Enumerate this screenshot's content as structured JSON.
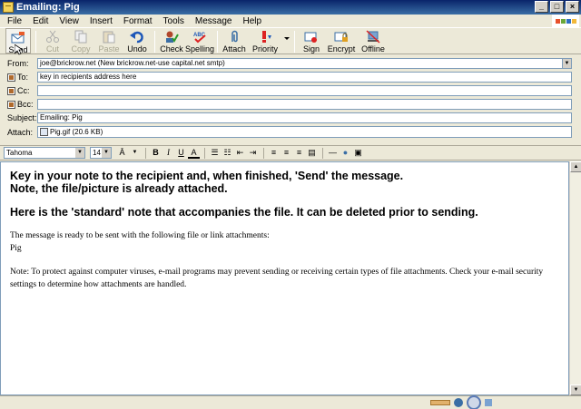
{
  "window": {
    "title": "Emailing: Pig"
  },
  "menu": [
    "File",
    "Edit",
    "View",
    "Insert",
    "Format",
    "Tools",
    "Message",
    "Help"
  ],
  "toolbar": {
    "send": "Send",
    "cut": "Cut",
    "copy": "Copy",
    "paste": "Paste",
    "undo": "Undo",
    "check": "Check",
    "spelling": "Spelling",
    "attach": "Attach",
    "priority": "Priority",
    "sign": "Sign",
    "encrypt": "Encrypt",
    "offline": "Offline"
  },
  "header": {
    "from_label": "From:",
    "from_value": "joe@brickrow.net    (New brickrow.net-use capital.net smtp)",
    "to_label": "To:",
    "to_value": "key in recipients address here",
    "cc_label": "Cc:",
    "cc_value": "",
    "bcc_label": "Bcc:",
    "bcc_value": "",
    "subject_label": "Subject:",
    "subject_value": "Emailing: Pig",
    "attach_label": "Attach:",
    "attach_value": "Pig.gif (20.6 KB)"
  },
  "format": {
    "font": "Tahoma",
    "size": "14"
  },
  "body": {
    "line1": "Key in your note to the recipient and, when finished, 'Send' the message.",
    "line2": "Note, the file/picture is already attached.",
    "line3": "Here is the 'standard' note that accompanies the file. It can be deleted prior to sending.",
    "line4": "The message is ready to be sent with the following file or link attachments:",
    "line5": "Pig",
    "line6": "Note: To protect against computer viruses, e-mail programs may prevent sending or receiving certain types of file attachments.  Check your e-mail security",
    "line7": "settings to determine how attachments are handled."
  }
}
